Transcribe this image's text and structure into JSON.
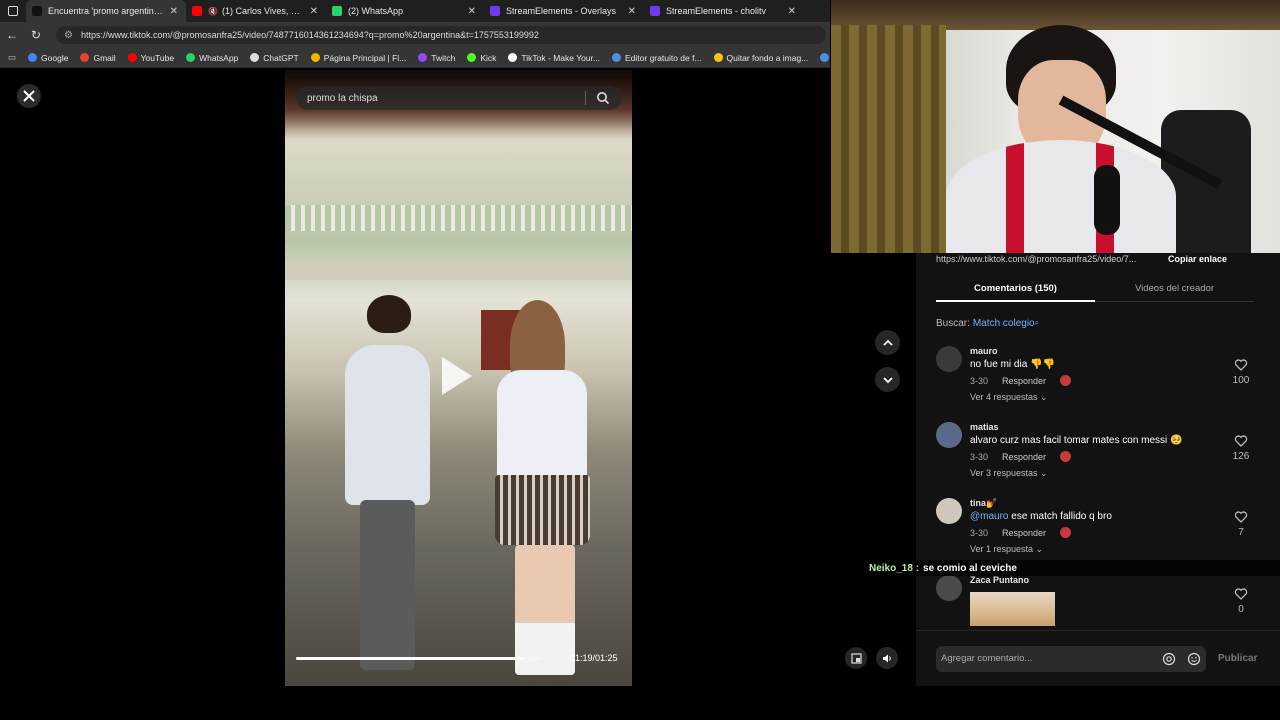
{
  "browser": {
    "tabs": [
      {
        "label": "Encuentra 'promo argentina' en TikTok",
        "active": true,
        "favicon_color": "#111111"
      },
      {
        "label": "(1) Carlos Vives, Sebastián Yatra",
        "active": false,
        "favicon_color": "#ff0000",
        "muted": true
      },
      {
        "label": "(2) WhatsApp",
        "active": false,
        "favicon_color": "#25d366"
      },
      {
        "label": "StreamElements - Overlays",
        "active": false,
        "favicon_color": "#6a3df0"
      },
      {
        "label": "StreamElements - cholitv",
        "active": false,
        "favicon_color": "#6a3df0"
      }
    ],
    "url": "https://www.tiktok.com/@promosanfra25/video/7487716014361234694?q=promo%20argentina&t=1757553199992",
    "bookmarks": [
      {
        "label": "Google",
        "color": "#4285f4"
      },
      {
        "label": "Gmail",
        "color": "#ea4335"
      },
      {
        "label": "YouTube",
        "color": "#ff0000"
      },
      {
        "label": "WhatsApp",
        "color": "#25d366"
      },
      {
        "label": "ChatGPT",
        "color": "#dddddd"
      },
      {
        "label": "Página Principal | Fl...",
        "color": "#f4b400"
      },
      {
        "label": "Twitch",
        "color": "#9146ff"
      },
      {
        "label": "Kick",
        "color": "#53fc18"
      },
      {
        "label": "TikTok - Make Your...",
        "color": "#ffffff"
      },
      {
        "label": "Editor gratuito de f...",
        "color": "#4a90e2"
      },
      {
        "label": "Quitar fondo a imag...",
        "color": "#f5c518"
      },
      {
        "label": "Inic",
        "color": "#4a90e2"
      }
    ]
  },
  "video": {
    "search_text": "promo la chispa",
    "time": "01:19/01:25",
    "progress": 0.93
  },
  "panel": {
    "share_url": "https://www.tiktok.com/@promosanfra25/video/7...",
    "copy_label": "Copiar enlace",
    "tab_comments": "Comentarios (150)",
    "tab_videos": "Videos del creador",
    "search_prefix": "Buscar:",
    "search_link": "Match colegio",
    "comments": [
      {
        "name": "mauro",
        "text": "no fue mi dia 👎👎",
        "date": "3-30",
        "reply": "Responder",
        "more": "Ver 4 respuestas ⌄",
        "likes": "100",
        "avatar_color": "#3a3a3a"
      },
      {
        "name": "matias",
        "text": "alvaro curz mas facil tomar mates con messi 🥺",
        "date": "3-30",
        "reply": "Responder",
        "more": "Ver 3 respuestas ⌄",
        "likes": "126",
        "avatar_color": "#5a6a8a"
      },
      {
        "name": "tina💅",
        "mention": "@mauro",
        "text": " ese match fallido q bro",
        "date": "3-30",
        "reply": "Responder",
        "more": "Ver 1 respuesta ⌄",
        "likes": "7",
        "avatar_color": "#cfc7bb"
      },
      {
        "name": "Zaca Puntano",
        "likes": "0",
        "avatar_color": "#4a4a4a"
      }
    ],
    "composer_placeholder": "Agregar comentario...",
    "post_label": "Publicar"
  },
  "chat_overlay": {
    "user": "Neiko_18 :",
    "message": "se comio al ceviche"
  },
  "icons": {
    "close": "close-icon",
    "search": "search-icon",
    "play": "play-icon",
    "up": "chevron-up-icon",
    "down": "chevron-down-icon",
    "heart": "heart-icon",
    "mention": "at-icon",
    "emoji": "emoji-icon",
    "volume": "volume-icon",
    "miniplayer": "miniplayer-icon"
  }
}
